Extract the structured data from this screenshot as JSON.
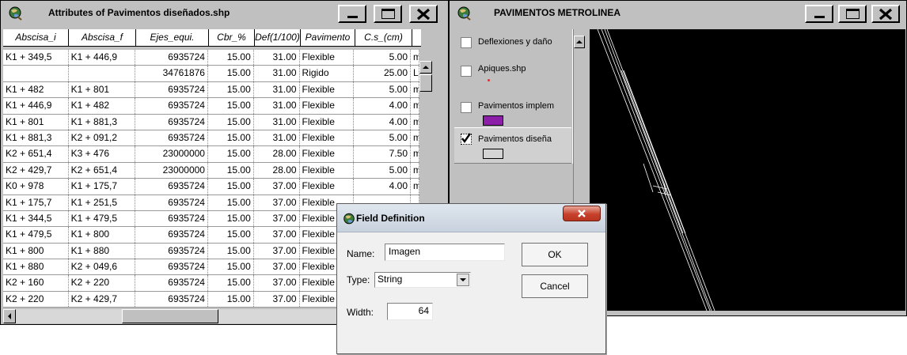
{
  "attr_window": {
    "title": "Attributes of Pavimentos diseñados.shp",
    "columns": [
      "Abscisa_i",
      "Abscisa_f",
      "Ejes_equi.",
      "Cbr_%",
      "Def(1/100)",
      "Pavimento",
      "C.s_(cm)"
    ],
    "rows": [
      [
        "K1 + 349,5",
        "K1 + 446,9",
        "6935724",
        "15.00",
        "31.00",
        "Flexible",
        "5.00",
        "m"
      ],
      [
        "",
        "",
        "34761876",
        "15.00",
        "31.00",
        "Rigido",
        "25.00",
        "L"
      ],
      [
        "K1 + 482",
        "K1 + 801",
        "6935724",
        "15.00",
        "31.00",
        "Flexible",
        "5.00",
        "m"
      ],
      [
        "K1 + 446,9",
        "K1 + 482",
        "6935724",
        "15.00",
        "31.00",
        "Flexible",
        "4.00",
        "m"
      ],
      [
        "K1 + 801",
        "K1 + 881,3",
        "6935724",
        "15.00",
        "31.00",
        "Flexible",
        "4.00",
        "m"
      ],
      [
        "K1 + 881,3",
        "K2 + 091,2",
        "6935724",
        "15.00",
        "31.00",
        "Flexible",
        "5.00",
        "m"
      ],
      [
        "K2 + 651,4",
        "K3 + 476",
        "23000000",
        "15.00",
        "28.00",
        "Flexible",
        "7.50",
        "m"
      ],
      [
        "K2 + 429,7",
        "K2 + 651,4",
        "23000000",
        "15.00",
        "28.00",
        "Flexible",
        "5.00",
        "m"
      ],
      [
        "K0 + 978",
        "K1 + 175,7",
        "6935724",
        "15.00",
        "37.00",
        "Flexible",
        "4.00",
        "m"
      ],
      [
        "K1 + 175,7",
        "K1 + 251,5",
        "6935724",
        "15.00",
        "37.00",
        "Flexible",
        "",
        ""
      ],
      [
        "K1 + 344,5",
        "K1 + 479,5",
        "6935724",
        "15.00",
        "37.00",
        "Flexible",
        "",
        ""
      ],
      [
        "K1 + 479,5",
        "K1 + 800",
        "6935724",
        "15.00",
        "37.00",
        "Flexible",
        "",
        ""
      ],
      [
        "K1 + 800",
        "K1 + 880",
        "6935724",
        "15.00",
        "37.00",
        "Flexible",
        "",
        ""
      ],
      [
        "K1 + 880",
        "K2 + 049,6",
        "6935724",
        "15.00",
        "37.00",
        "Flexible",
        "",
        ""
      ],
      [
        "K2 + 160",
        "K2 + 220",
        "6935724",
        "15.00",
        "37.00",
        "Flexible",
        "",
        ""
      ],
      [
        "K2 + 220",
        "K2 + 429,7",
        "6935724",
        "15.00",
        "37.00",
        "Flexible",
        "",
        ""
      ]
    ]
  },
  "view_window": {
    "title": "PAVIMENTOS METROLINEA",
    "layers": [
      {
        "label": "Deflexiones y daño",
        "checked": false,
        "symbol": "none"
      },
      {
        "label": "Apiques.shp",
        "checked": false,
        "symbol": "point"
      },
      {
        "label": "Pavimentos implem",
        "checked": false,
        "symbol": "fill",
        "color": "#8b1fa8"
      },
      {
        "label": "Pavimentos diseña",
        "checked": true,
        "symbol": "fill",
        "color": "#d4d4d4"
      }
    ],
    "point_color": "#e03030",
    "canvas_color": "#000000",
    "line_color": "#ffffff"
  },
  "dialog": {
    "title": "Field Definition",
    "name_label": "Name:",
    "name_value": "Imagen",
    "type_label": "Type:",
    "type_value": "String",
    "width_label": "Width:",
    "width_value": "64",
    "ok_label": "OK",
    "cancel_label": "Cancel"
  }
}
